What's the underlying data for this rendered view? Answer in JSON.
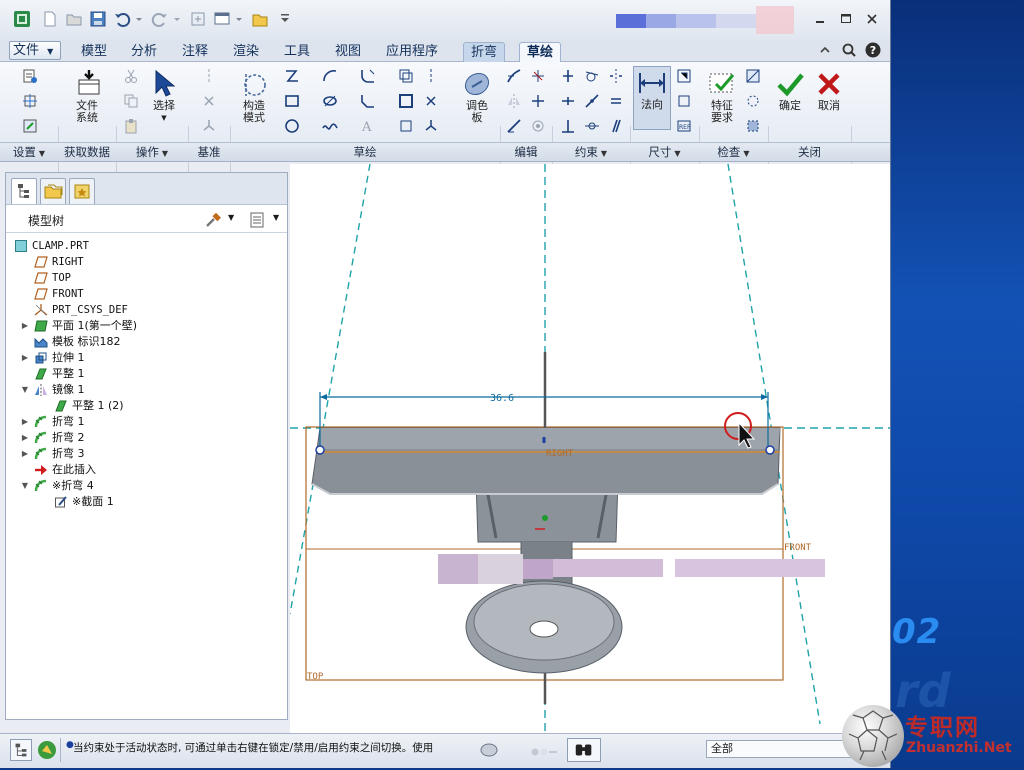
{
  "desktop": {
    "brand_digits": "02",
    "brand_ghost": "rd",
    "watermark_cn": "专职网",
    "watermark_url": "Zhuanzhi.Net"
  },
  "menu_tabs": [
    {
      "label": "文件",
      "icon": "dropdown-arrow"
    },
    {
      "label": "模型"
    },
    {
      "label": "分析"
    },
    {
      "label": "注释"
    },
    {
      "label": "渲染"
    },
    {
      "label": "工具"
    },
    {
      "label": "视图"
    },
    {
      "label": "应用程序"
    },
    {
      "label": "折弯"
    },
    {
      "label": "草绘"
    }
  ],
  "ribbon": {
    "file_system": "文件\n系统",
    "select": "选择",
    "construction_mode": "构造\n模式",
    "palette": "调色\n板",
    "normal": "法向",
    "feature_req": "特征\n要求",
    "ok": "确定",
    "cancel": "取消"
  },
  "ribbon_groups": [
    {
      "label": "设置",
      "arrow": true
    },
    {
      "label": "获取数据",
      "arrow": false
    },
    {
      "label": "操作",
      "arrow": true
    },
    {
      "label": "基准",
      "arrow": false
    },
    {
      "label": "草绘",
      "arrow": false
    },
    {
      "label": "编辑",
      "arrow": false
    },
    {
      "label": "约束",
      "arrow": true
    },
    {
      "label": "尺寸",
      "arrow": true
    },
    {
      "label": "检查",
      "arrow": true
    },
    {
      "label": "关闭",
      "arrow": false
    }
  ],
  "model_tree": {
    "title": "模型树",
    "items": [
      {
        "label": "CLAMP.PRT",
        "icon": "part-icon"
      },
      {
        "label": "RIGHT",
        "icon": "datum-plane-icon"
      },
      {
        "label": "TOP",
        "icon": "datum-plane-icon"
      },
      {
        "label": "FRONT",
        "icon": "datum-plane-icon"
      },
      {
        "label": "PRT_CSYS_DEF",
        "icon": "csys-icon"
      },
      {
        "label": "平面 1(第一个壁)",
        "icon": "flat-wall-icon"
      },
      {
        "label": "模板 标识182",
        "icon": "template-icon"
      },
      {
        "label": "拉伸 1",
        "icon": "extrude-icon"
      },
      {
        "label": "平整 1",
        "icon": "flat-icon"
      },
      {
        "label": "镜像 1",
        "icon": "mirror-icon"
      },
      {
        "label": "平整 1 (2)",
        "icon": "flat-icon"
      },
      {
        "label": "折弯 1",
        "icon": "bend-icon"
      },
      {
        "label": "折弯 2",
        "icon": "bend-icon"
      },
      {
        "label": "折弯 3",
        "icon": "bend-icon"
      },
      {
        "label": "在此插入",
        "icon": "insert-arrow-icon"
      },
      {
        "label": "※折弯 4",
        "icon": "bend-icon"
      },
      {
        "label": "※截面 1",
        "icon": "section-icon"
      }
    ]
  },
  "canvas": {
    "dimension_value": "36.6",
    "label_right": "RIGHT",
    "label_front": "FRONT",
    "label_top": "TOP"
  },
  "status": {
    "message": "当约束处于活动状态时, 可通过单击右键在锁定/禁用/启用约束之间切换。使用",
    "filter_value": "全部"
  },
  "colors": {
    "accent": "#1b3d7a",
    "ok": "#1e9a2a",
    "cancel": "#c01818",
    "datum": "#c06a1a",
    "centerline": "#1fa3a8",
    "dimension": "#0c6b9e"
  }
}
